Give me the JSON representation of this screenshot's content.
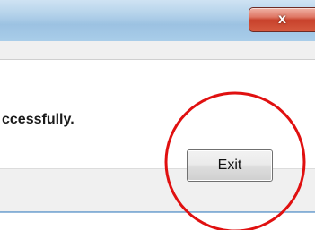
{
  "window": {
    "close_glyph": "x",
    "message": "ccessfully.",
    "exit_label": "Exit"
  },
  "annotation": {
    "color": "#e01010",
    "shape": "circle"
  }
}
